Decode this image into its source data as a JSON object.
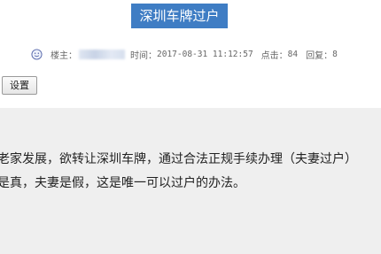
{
  "header": {
    "title": "深圳车牌过户"
  },
  "meta": {
    "icon": "smile-icon",
    "author_label": "楼主：",
    "time_label": "时间：",
    "time_value": "2017-08-31 11:12:57",
    "clicks_label": "点击：",
    "clicks_value": "84",
    "replies_label": "回复：",
    "replies_value": "8"
  },
  "toolbar": {
    "settings_label": "设置"
  },
  "post": {
    "line1": "老家发展，欲转让深圳车牌，通过合法正规手续办理（夫妻过户）",
    "line2": "是真，夫妻是假，这是唯一可以过户的办法。"
  },
  "colors": {
    "title_bg": "#3f7dc4",
    "content_bg": "#efefef"
  }
}
